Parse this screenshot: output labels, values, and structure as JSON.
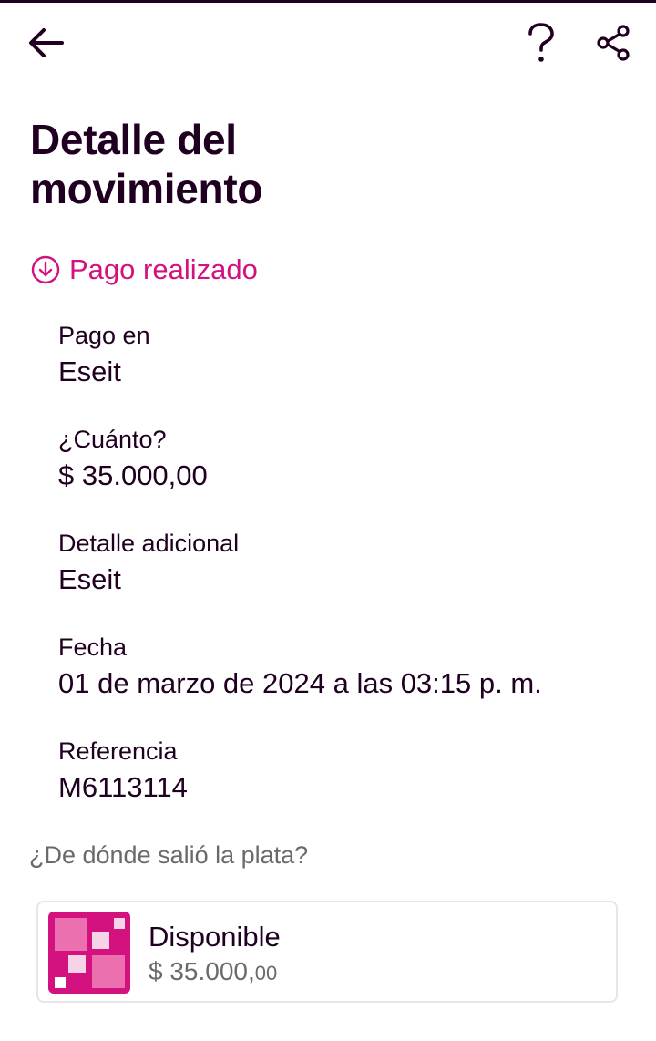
{
  "header": {
    "back_icon": "arrow-left-icon",
    "help_icon": "question-icon",
    "share_icon": "share-icon"
  },
  "page_title_line1": "Detalle del",
  "page_title_line2": "movimiento",
  "status": {
    "icon": "arrow-down-circle-icon",
    "label": "Pago realizado",
    "color": "#d4127f"
  },
  "fields": [
    {
      "label": "Pago en",
      "value": "Eseit"
    },
    {
      "label": "¿Cuánto?",
      "value": "$ 35.000,00"
    },
    {
      "label": "Detalle adicional",
      "value": "Eseit"
    },
    {
      "label": "Fecha",
      "value": "01 de marzo de 2024 a las 03:15 p. m."
    },
    {
      "label": "Referencia",
      "value": "M6113114"
    }
  ],
  "source": {
    "question": "¿De dónde salió la plata?",
    "account": {
      "name": "Disponible",
      "amount_main": "$ 35.000,",
      "amount_cents": "00",
      "icon": "pocket-logo-icon",
      "brand_color": "#d4127f"
    }
  }
}
